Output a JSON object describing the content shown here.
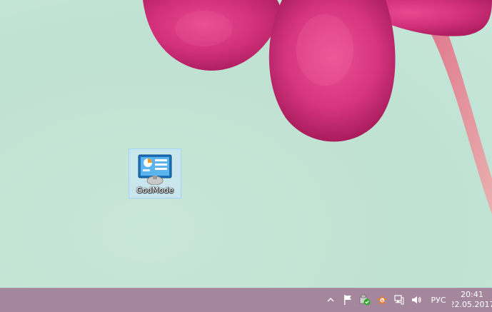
{
  "desktop": {
    "icons": [
      {
        "label": "GodMode",
        "icon": "control-panel-icon",
        "selected": true
      }
    ]
  },
  "taskbar": {
    "tray": {
      "icons": [
        "chevron-up-icon",
        "action-center-flag-icon",
        "network-security-icon",
        "avast-icon",
        "network-icon",
        "volume-icon"
      ],
      "language": "РУС",
      "time": "20:41",
      "date": "22.05.2017"
    }
  },
  "colors": {
    "taskbar": "#a4879c",
    "petal": "#d8357e",
    "wallpaper": "#c3e3d3"
  }
}
